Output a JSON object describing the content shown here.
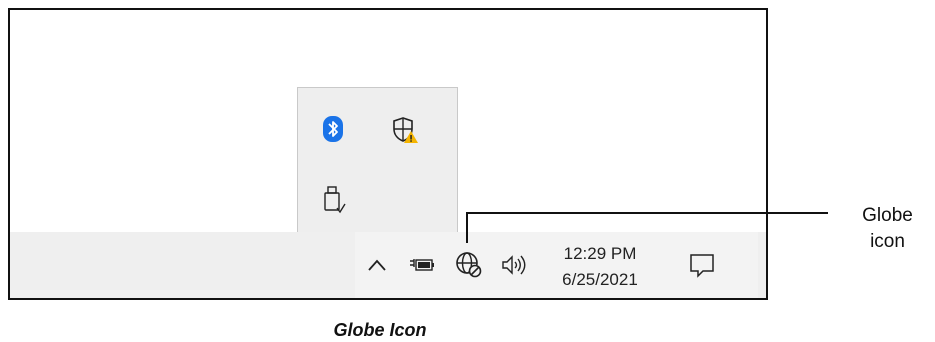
{
  "tray_flyout": {
    "icons": [
      "bluetooth-icon",
      "windows-security-warning-icon",
      "usb-safely-remove-icon"
    ]
  },
  "taskbar": {
    "show_hidden_icons": "chevron-up-icon",
    "status_icons": [
      "battery-charging-icon",
      "globe-network-icon",
      "speaker-volume-icon"
    ],
    "clock": {
      "time": "12:29 PM",
      "date": "6/25/2021"
    },
    "notifications": "action-center-icon"
  },
  "callout": {
    "line1": "Globe",
    "line2": "icon"
  },
  "caption": "Globe Icon",
  "colors": {
    "bluetooth": "#1a73e8",
    "shield_warning": "#f4b400",
    "taskbar": "#efefef"
  }
}
